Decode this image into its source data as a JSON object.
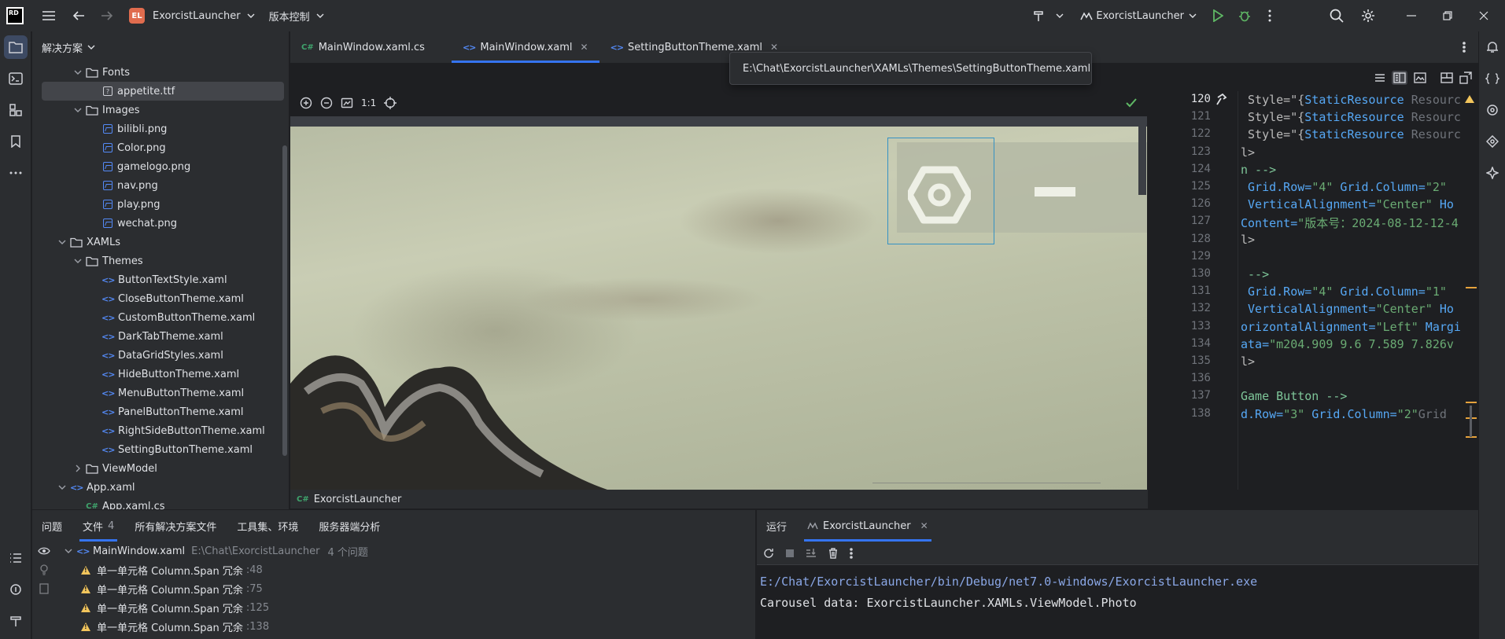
{
  "titlebar": {
    "project_badge": "EL",
    "project_name": "ExorcistLauncher",
    "vcs_label": "版本控制",
    "run_config": "ExorcistLauncher"
  },
  "project_panel": {
    "title": "解决方案",
    "tree": [
      {
        "label": "Fonts",
        "type": "folder",
        "depth": 3,
        "expanded": true
      },
      {
        "label": "appetite.ttf",
        "type": "font",
        "depth": 4,
        "selected": true
      },
      {
        "label": "Images",
        "type": "folder",
        "depth": 3,
        "expanded": true
      },
      {
        "label": "bilibli.png",
        "type": "image",
        "depth": 4
      },
      {
        "label": "Color.png",
        "type": "image",
        "depth": 4
      },
      {
        "label": "gamelogo.png",
        "type": "image",
        "depth": 4
      },
      {
        "label": "nav.png",
        "type": "image",
        "depth": 4
      },
      {
        "label": "play.png",
        "type": "image",
        "depth": 4
      },
      {
        "label": "wechat.png",
        "type": "image",
        "depth": 4
      },
      {
        "label": "XAMLs",
        "type": "folder",
        "depth": 2,
        "expanded": true
      },
      {
        "label": "Themes",
        "type": "folder",
        "depth": 3,
        "expanded": true
      },
      {
        "label": "ButtonTextStyle.xaml",
        "type": "xaml",
        "depth": 4
      },
      {
        "label": "CloseButtonTheme.xaml",
        "type": "xaml",
        "depth": 4
      },
      {
        "label": "CustomButtonTheme.xaml",
        "type": "xaml",
        "depth": 4
      },
      {
        "label": "DarkTabTheme.xaml",
        "type": "xaml",
        "depth": 4
      },
      {
        "label": "DataGridStyles.xaml",
        "type": "xaml",
        "depth": 4
      },
      {
        "label": "HideButtonTheme.xaml",
        "type": "xaml",
        "depth": 4
      },
      {
        "label": "MenuButtonTheme.xaml",
        "type": "xaml",
        "depth": 4
      },
      {
        "label": "PanelButtonTheme.xaml",
        "type": "xaml",
        "depth": 4
      },
      {
        "label": "RightSideButtonTheme.xaml",
        "type": "xaml",
        "depth": 4
      },
      {
        "label": "SettingButtonTheme.xaml",
        "type": "xaml",
        "depth": 4
      },
      {
        "label": "ViewModel",
        "type": "folder",
        "depth": 3,
        "expanded": false
      },
      {
        "label": "App.xaml",
        "type": "xaml",
        "depth": 2,
        "expanded": true
      },
      {
        "label": "App.xaml.cs",
        "type": "cs",
        "depth": 3
      }
    ]
  },
  "editor": {
    "tabs": [
      {
        "label": "MainWindow.xaml.cs",
        "icon": "C#",
        "active": false,
        "closable": false
      },
      {
        "label": "MainWindow.xaml",
        "icon": "<>",
        "active": true,
        "closable": true
      },
      {
        "label": "SettingButtonTheme.xaml",
        "icon": "<>",
        "active": false,
        "closable": true
      }
    ],
    "tooltip": "E:\\Chat\\ExorcistLauncher\\XAMLs\\Themes\\SettingButtonTheme.xaml",
    "zoom_label": "1:1",
    "breadcrumb": "ExorcistLauncher"
  },
  "code": {
    "lines": [
      {
        "n": "120",
        "parts": [
          [
            " Style=\"{",
            "c-attr"
          ],
          [
            "StaticResource",
            "c-kw"
          ],
          [
            " Resourc",
            "c-gray"
          ]
        ]
      },
      {
        "n": "121",
        "parts": [
          [
            " Style=\"{",
            "c-attr"
          ],
          [
            "StaticResource",
            "c-kw"
          ],
          [
            " Resourc",
            "c-gray"
          ]
        ]
      },
      {
        "n": "122",
        "parts": [
          [
            " Style=\"{",
            "c-attr"
          ],
          [
            "StaticResource",
            "c-kw"
          ],
          [
            " Resourc",
            "c-gray"
          ]
        ]
      },
      {
        "n": "123",
        "parts": [
          [
            "l>",
            "c-attr"
          ]
        ]
      },
      {
        "n": "124",
        "parts": [
          [
            "n -->",
            "c-cmt"
          ]
        ]
      },
      {
        "n": "125",
        "parts": [
          [
            " Grid.Row=",
            "c-kw"
          ],
          [
            "\"4\"",
            "c-str"
          ],
          [
            " Grid.Column=",
            "c-kw"
          ],
          [
            "\"2\"",
            "c-str"
          ]
        ]
      },
      {
        "n": "126",
        "parts": [
          [
            " VerticalAlignment=",
            "c-kw"
          ],
          [
            "\"Center\"",
            "c-str"
          ],
          [
            " Ho",
            "c-kw"
          ]
        ]
      },
      {
        "n": "127",
        "parts": [
          [
            "Content=",
            "c-kw"
          ],
          [
            "\"版本号：2024-08-12-12-4",
            "c-str"
          ]
        ]
      },
      {
        "n": "128",
        "parts": [
          [
            "l>",
            "c-attr"
          ]
        ]
      },
      {
        "n": "129",
        "parts": [
          [
            "",
            "c-attr"
          ]
        ]
      },
      {
        "n": "130",
        "parts": [
          [
            " -->",
            "c-cmt"
          ]
        ]
      },
      {
        "n": "131",
        "parts": [
          [
            " Grid.Row=",
            "c-kw"
          ],
          [
            "\"4\"",
            "c-str"
          ],
          [
            " Grid.Column=",
            "c-kw"
          ],
          [
            "\"1\"",
            "c-str"
          ]
        ]
      },
      {
        "n": "132",
        "parts": [
          [
            " VerticalAlignment=",
            "c-kw"
          ],
          [
            "\"Center\"",
            "c-str"
          ],
          [
            " Ho",
            "c-kw"
          ]
        ]
      },
      {
        "n": "133",
        "parts": [
          [
            "orizontalAlignment=",
            "c-kw"
          ],
          [
            "\"Left\"",
            "c-str"
          ],
          [
            " Margi",
            "c-kw"
          ]
        ]
      },
      {
        "n": "134",
        "parts": [
          [
            "ata=",
            "c-kw"
          ],
          [
            "\"m204.909 9.6 7.589 7.826v",
            "c-str"
          ]
        ]
      },
      {
        "n": "135",
        "parts": [
          [
            "l>",
            "c-attr"
          ]
        ]
      },
      {
        "n": "136",
        "parts": [
          [
            "",
            "c-attr"
          ]
        ]
      },
      {
        "n": "137",
        "parts": [
          [
            "Game Button -->",
            "c-cmt"
          ]
        ]
      },
      {
        "n": "138",
        "parts": [
          [
            "d.Row=",
            "c-kw"
          ],
          [
            "\"3\"",
            "c-str"
          ],
          [
            " Grid.Column=",
            "c-kw"
          ],
          [
            "\"2\"",
            "c-str"
          ],
          [
            "Grid",
            "c-gray"
          ]
        ]
      }
    ]
  },
  "problems": {
    "tabs": [
      {
        "label": "问题",
        "active": false
      },
      {
        "label": "文件",
        "count": "4",
        "active": true
      },
      {
        "label": "所有解决方案文件",
        "active": false
      },
      {
        "label": "工具集、环境",
        "active": false
      },
      {
        "label": "服务器端分析",
        "active": false
      }
    ],
    "file": {
      "name": "MainWindow.xaml",
      "path": "E:\\Chat\\ExorcistLauncher",
      "count_text": "4 个问题"
    },
    "items": [
      {
        "text": "单一单元格 Column.Span 冗余",
        "line": ":48"
      },
      {
        "text": "单一单元格 Column.Span 冗余",
        "line": ":75"
      },
      {
        "text": "单一单元格 Column.Span 冗余",
        "line": ":125"
      },
      {
        "text": "单一单元格 Column.Span 冗余",
        "line": ":138"
      }
    ]
  },
  "run": {
    "tab_label": "运行",
    "config_tab": "ExorcistLauncher",
    "console": [
      {
        "text": "E:/Chat/ExorcistLauncher/bin/Debug/net7.0-windows/ExorcistLauncher.exe",
        "style": "link"
      },
      {
        "text": "Carousel data: ExorcistLauncher.XAMLs.ViewModel.Photo",
        "style": "plain"
      }
    ]
  }
}
